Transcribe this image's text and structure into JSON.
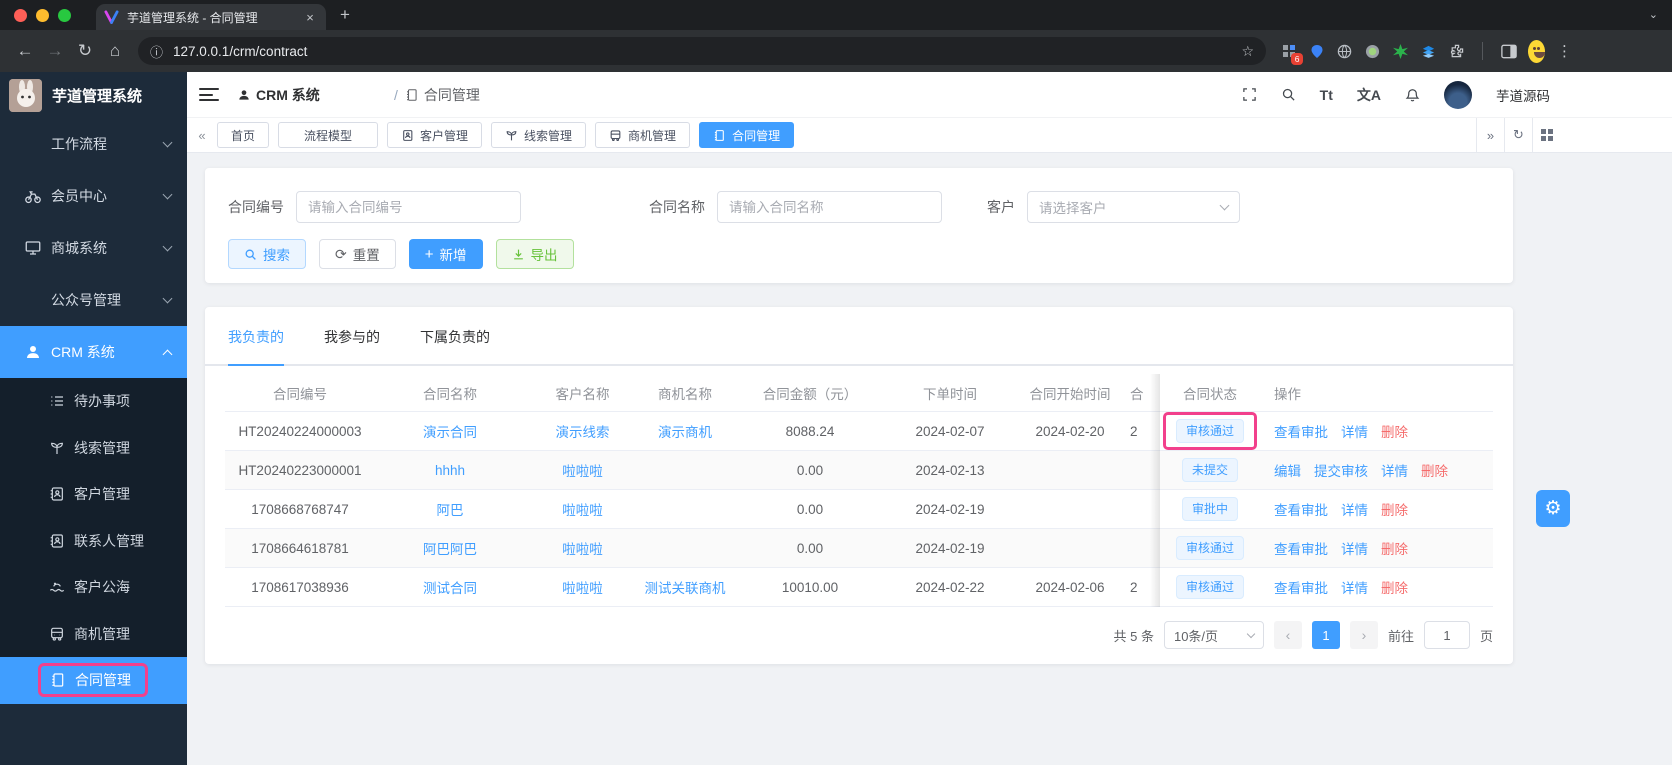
{
  "browser": {
    "tab_title": "芋道管理系统 - 合同管理",
    "url": "127.0.0.1/crm/contract",
    "extension_badge": "6"
  },
  "sidebar": {
    "title": "芋道管理系统",
    "items": [
      {
        "label": "工作流程",
        "icon": "none",
        "expanded": false
      },
      {
        "label": "会员中心",
        "icon": "bicycle-icon",
        "expanded": false
      },
      {
        "label": "商城系统",
        "icon": "monitor-icon",
        "expanded": false
      },
      {
        "label": "公众号管理",
        "icon": "none",
        "expanded": false
      },
      {
        "label": "CRM 系统",
        "icon": "user-icon",
        "expanded": true,
        "active": true
      }
    ],
    "crm_children": [
      {
        "label": "待办事项",
        "icon": "todo-list-icon"
      },
      {
        "label": "线索管理",
        "icon": "seedling-icon"
      },
      {
        "label": "客户管理",
        "icon": "contact-book-icon"
      },
      {
        "label": "联系人管理",
        "icon": "contact-book-icon"
      },
      {
        "label": "客户公海",
        "icon": "sea-waves-icon"
      },
      {
        "label": "商机管理",
        "icon": "bus-icon"
      },
      {
        "label": "合同管理",
        "icon": "contract-icon",
        "active": true,
        "annotated": true
      }
    ]
  },
  "header": {
    "breadcrumb": {
      "root": "CRM 系统",
      "separator": "/",
      "current": "合同管理"
    },
    "font_icon": "Tt",
    "lang_icon": "文A",
    "user_name": "芋道源码"
  },
  "tagbar": {
    "tags": [
      {
        "label": "首页"
      },
      {
        "label": "流程模型"
      },
      {
        "label": "客户管理",
        "icon": "contact-book-icon"
      },
      {
        "label": "线索管理",
        "icon": "seedling-icon"
      },
      {
        "label": "商机管理",
        "icon": "bus-icon"
      },
      {
        "label": "合同管理",
        "icon": "contract-icon",
        "active": true
      }
    ]
  },
  "search": {
    "fields": [
      {
        "label": "合同编号",
        "placeholder": "请输入合同编号"
      },
      {
        "label": "合同名称",
        "placeholder": "请输入合同名称"
      },
      {
        "label": "客户",
        "placeholder": "请选择客户"
      }
    ],
    "buttons": {
      "search": "搜索",
      "reset": "重置",
      "add": "新增",
      "export": "导出"
    }
  },
  "content_tabs": [
    {
      "label": "我负责的",
      "active": true
    },
    {
      "label": "我参与的",
      "active": false
    },
    {
      "label": "下属负责的",
      "active": false
    }
  ],
  "table": {
    "columns": [
      "合同编号",
      "合同名称",
      "客户名称",
      "商机名称",
      "合同金额（元）",
      "下单时间",
      "合同开始时间",
      "合",
      "合同状态",
      "操作"
    ],
    "rows": [
      {
        "cells": [
          "HT20240224000003",
          "演示合同",
          "演示线索",
          "演示商机",
          "8088.24",
          "2024-02-07",
          "2024-02-20",
          "2"
        ],
        "status": "审核通过",
        "annotated": true,
        "actions": [
          {
            "label": "查看审批"
          },
          {
            "label": "详情"
          },
          {
            "label": "删除"
          }
        ]
      },
      {
        "cells": [
          "HT20240223000001",
          "hhhh",
          "啦啦啦",
          "",
          "0.00",
          "2024-02-13",
          "",
          ""
        ],
        "status": "未提交",
        "annotated": false,
        "actions": [
          {
            "label": "编辑"
          },
          {
            "label": "提交审核"
          },
          {
            "label": "详情"
          },
          {
            "label": "删除"
          }
        ]
      },
      {
        "cells": [
          "1708668768747",
          "阿巴",
          "啦啦啦",
          "",
          "0.00",
          "2024-02-19",
          "",
          ""
        ],
        "status": "审批中",
        "annotated": false,
        "actions": [
          {
            "label": "查看审批"
          },
          {
            "label": "详情"
          },
          {
            "label": "删除"
          }
        ]
      },
      {
        "cells": [
          "1708664618781",
          "阿巴阿巴",
          "啦啦啦",
          "",
          "0.00",
          "2024-02-19",
          "",
          ""
        ],
        "status": "审核通过",
        "annotated": false,
        "actions": [
          {
            "label": "查看审批"
          },
          {
            "label": "详情"
          },
          {
            "label": "删除"
          }
        ]
      },
      {
        "cells": [
          "1708617038936",
          "测试合同",
          "啦啦啦",
          "测试关联商机",
          "10010.00",
          "2024-02-22",
          "2024-02-06",
          "2"
        ],
        "status": "审核通过",
        "annotated": false,
        "actions": [
          {
            "label": "查看审批"
          },
          {
            "label": "详情"
          },
          {
            "label": "删除"
          }
        ]
      }
    ]
  },
  "pagination": {
    "total": "共 5 条",
    "page_size": "10条/页",
    "current_page": "1",
    "goto_label": "前往",
    "goto_value": "1",
    "page_unit": "页"
  },
  "colors": {
    "primary": "#409eff",
    "danger": "#f56c6c",
    "success": "#67c23a",
    "annotation_pink": "#f2408c",
    "sidebar_bg": "#1d2b3a",
    "submenu_bg": "#141f2b",
    "content_bg": "#f0f2f5"
  }
}
